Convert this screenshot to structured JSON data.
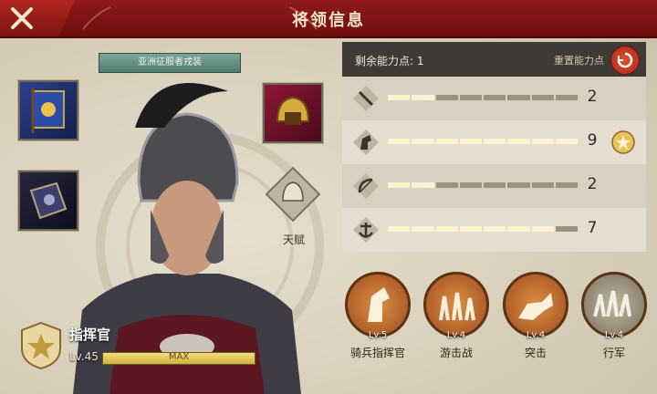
{
  "header": {
    "title": "将领信息",
    "close_icon": "close-icon"
  },
  "left": {
    "skin_label": "亚洲征服者戎装",
    "talent_label": "天赋",
    "commander": {
      "rank": "指挥官",
      "level": "Lv.45",
      "xp_label": "MAX",
      "xp_fraction": 1.0
    }
  },
  "stats": {
    "points_label": "剩余能力点: 1",
    "reset_label": "重置能力点",
    "rows": [
      {
        "icon": "sword-icon",
        "filled": 2,
        "total": 8,
        "value": "2"
      },
      {
        "icon": "horse-icon",
        "filled": 8,
        "total": 8,
        "value": "9"
      },
      {
        "icon": "bow-icon",
        "filled": 2,
        "total": 8,
        "value": "2"
      },
      {
        "icon": "anchor-icon",
        "filled": 7,
        "total": 8,
        "value": "7"
      }
    ]
  },
  "skills": [
    {
      "level": "Lv.5",
      "name": "骑兵指挥官"
    },
    {
      "level": "Lv.4",
      "name": "游击战"
    },
    {
      "level": "Lv.4",
      "name": "突击"
    },
    {
      "level": "Lv.4",
      "name": "行军"
    }
  ],
  "colors": {
    "header": "#8e1a19",
    "accent": "#d1b242",
    "skill": "#b1602a"
  }
}
